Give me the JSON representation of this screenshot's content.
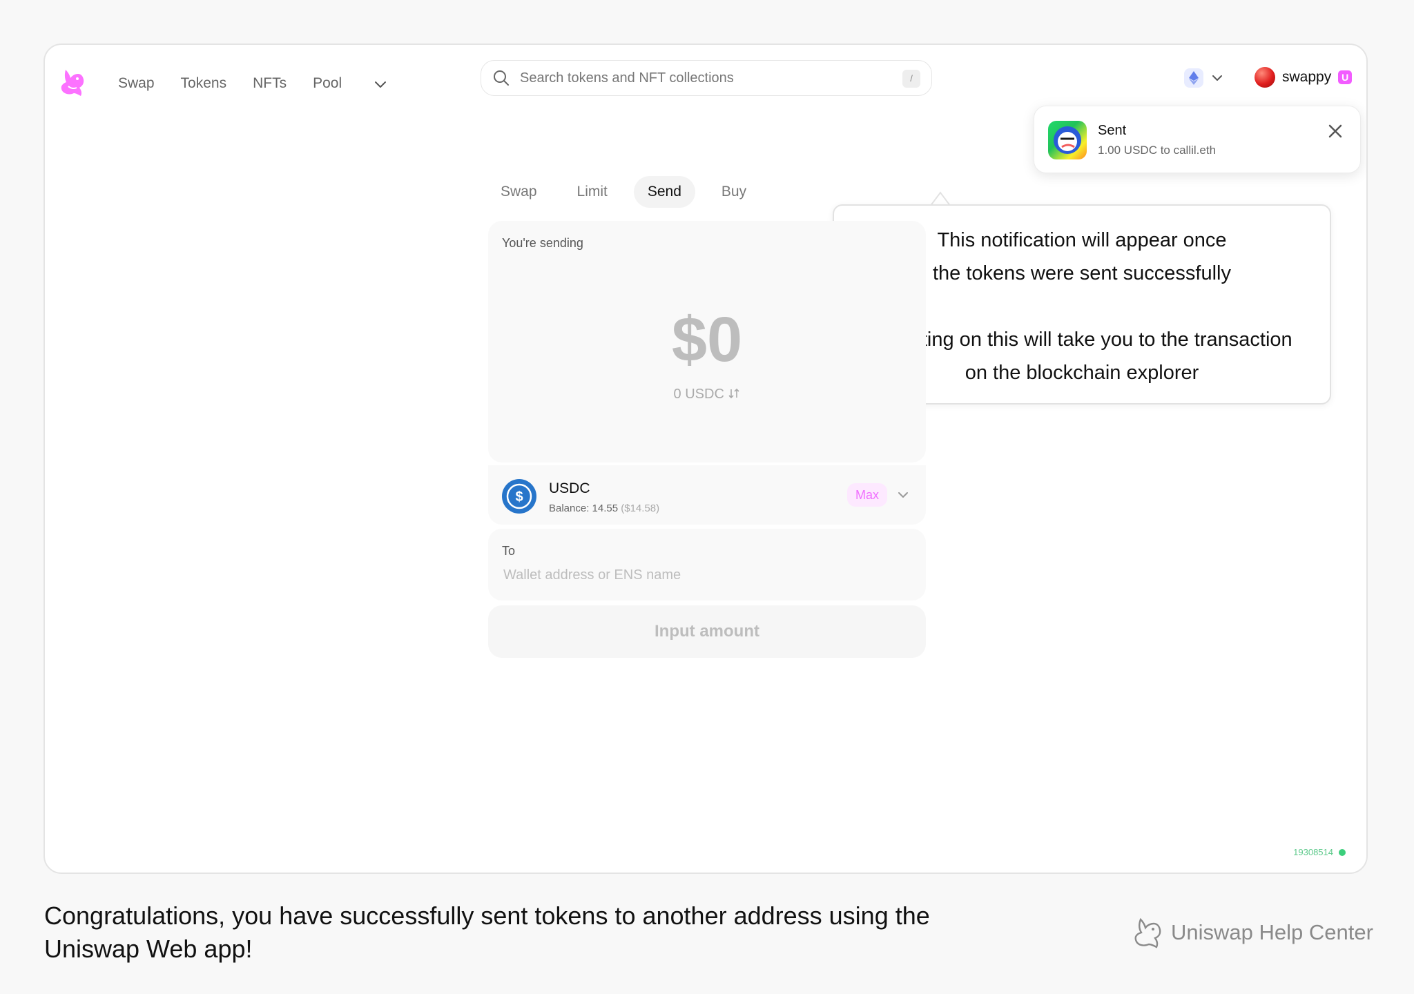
{
  "nav": {
    "links": [
      "Swap",
      "Tokens",
      "NFTs",
      "Pool"
    ]
  },
  "search": {
    "placeholder": "Search tokens and NFT collections",
    "shortcut": "/"
  },
  "account": {
    "name": "swappy",
    "badge": "U"
  },
  "toast": {
    "title": "Sent",
    "subtitle": "1.00 USDC to callil.eth"
  },
  "callout": {
    "line1": "This notification will appear once",
    "line2": "the tokens were sent successfully",
    "line3": "Selecting on this will take you to the transaction",
    "line4": "on the blockchain explorer"
  },
  "tabs": [
    "Swap",
    "Limit",
    "Send",
    "Buy"
  ],
  "send": {
    "label": "You're sending",
    "amount": "$0",
    "amount_sub": "0 USDC",
    "token": {
      "symbol": "USDC",
      "balance": "Balance: 14.55",
      "balance_usd": "($14.58)",
      "max": "Max"
    },
    "to": {
      "label": "To",
      "placeholder": "Wallet address or ENS name"
    },
    "button": "Input amount"
  },
  "block_number": "19308514",
  "footer": {
    "caption": "Congratulations, you have successfully sent tokens to another address using the Uniswap Web app!",
    "help": "Uniswap Help Center"
  },
  "colors": {
    "accent_pink": "#f06fff",
    "status_green": "#3ccf7c",
    "usdc_blue": "#2775ca"
  }
}
